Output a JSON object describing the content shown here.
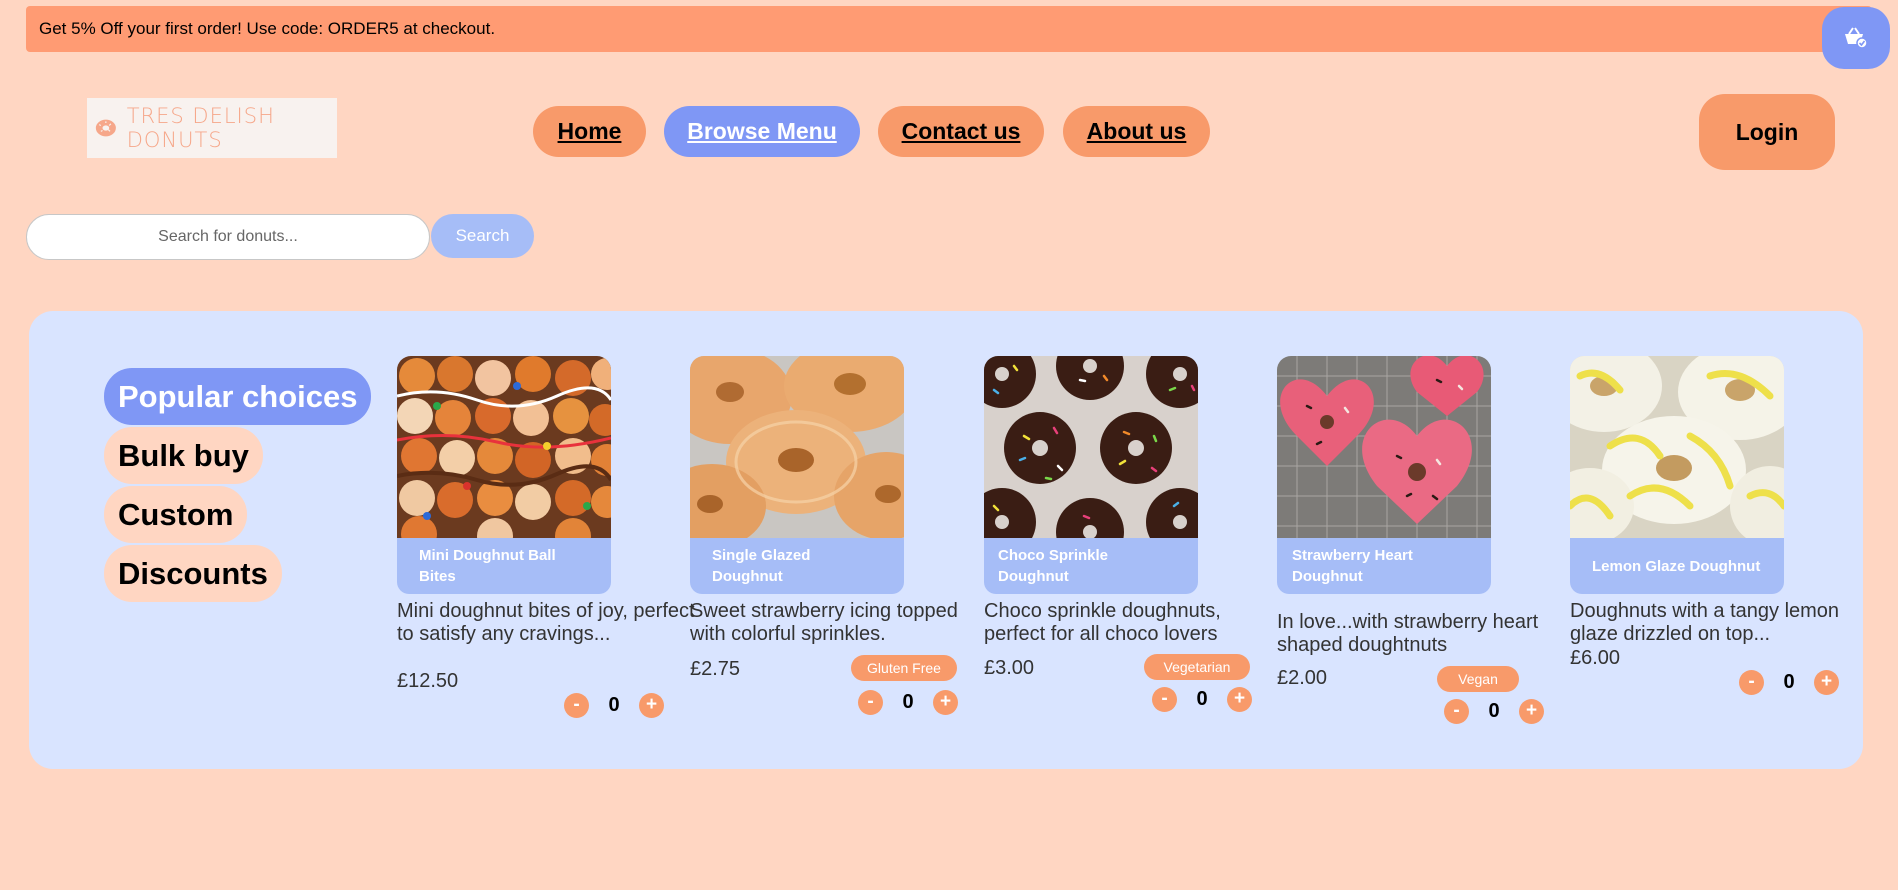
{
  "promo": {
    "text": "Get 5% Off your first order! Use code: ORDER5 at checkout."
  },
  "cart": {
    "icon": "cart-icon"
  },
  "brand": {
    "logo_text": "TRES DELISH DONUTS",
    "accent": "#f89a6a",
    "active": "#7f97f5"
  },
  "nav": {
    "home": "Home",
    "browse": "Browse Menu",
    "contact": "Contact us",
    "about": "About us",
    "login": "Login"
  },
  "search": {
    "placeholder": "Search for donuts...",
    "button": "Search"
  },
  "categories": [
    {
      "label": "Popular choices",
      "active": true
    },
    {
      "label": "Bulk buy",
      "active": false
    },
    {
      "label": "Custom",
      "active": false
    },
    {
      "label": "Discounts",
      "active": false
    }
  ],
  "products": [
    {
      "name": "Mini Doughnut Ball Bites",
      "description": "Mini doughnut bites of joy, perfect to satisfy any cravings...",
      "price": "£12.50",
      "badge": "",
      "quantity": "0"
    },
    {
      "name": "Single Glazed Doughnut",
      "description": "Sweet strawberry icing topped with colorful sprinkles.",
      "price": "£2.75",
      "badge": "Gluten Free",
      "quantity": "0"
    },
    {
      "name": "Choco Sprinkle Doughnut",
      "description": "Choco sprinkle doughnuts, perfect for all choco lovers",
      "price": "£3.00",
      "badge": "Vegetarian",
      "quantity": "0"
    },
    {
      "name": "Strawberry Heart Doughnut",
      "description": "In love...with strawberry heart shaped doughtnuts",
      "price": "£2.00",
      "badge": "Vegan",
      "quantity": "0"
    },
    {
      "name": "Lemon Glaze Doughnut",
      "description": "Doughnuts with a tangy lemon glaze drizzled on top...",
      "price": "£6.00",
      "badge": "",
      "quantity": "0"
    }
  ],
  "qty_controls": {
    "minus": "-",
    "plus": "+"
  }
}
